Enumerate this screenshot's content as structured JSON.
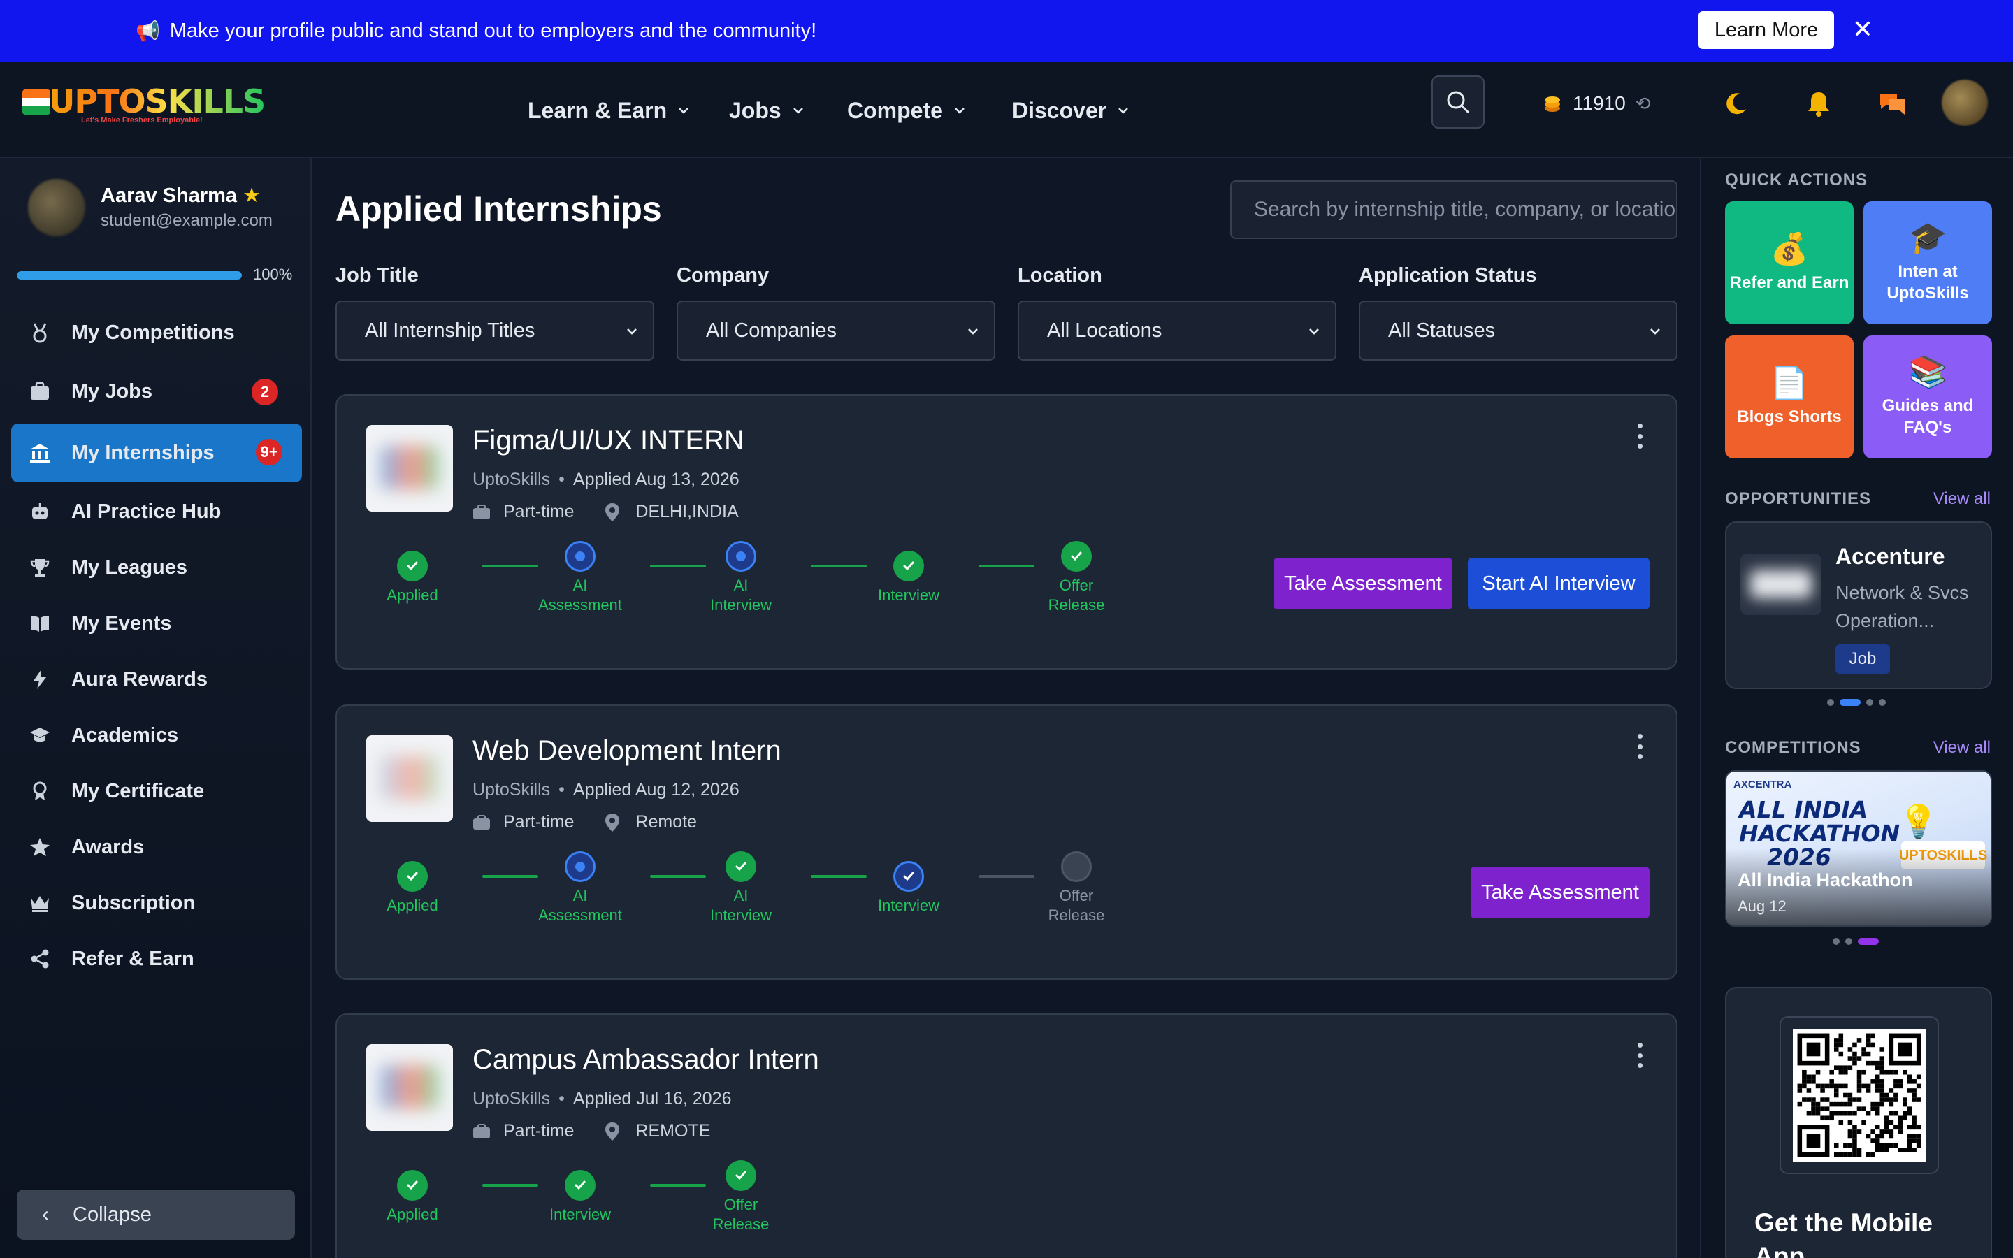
{
  "banner": {
    "icon": "megaphone-icon",
    "message": "Make your profile public and stand out to employers and the community!",
    "learn_more": "Learn More",
    "close": "✕",
    "bg_color": "#1216ee"
  },
  "header": {
    "logo_text": "UPTOSKILLS",
    "logo_tagline": "Let's Make Freshers Employable!",
    "nav": [
      "Learn & Earn",
      "Jobs",
      "Compete",
      "Discover"
    ],
    "coins": "11910"
  },
  "profile": {
    "name": "Aarav Sharma",
    "email": "student@example.com",
    "progress_label": "100%",
    "progress_fraction": 1.0
  },
  "sidebar": {
    "items": [
      {
        "label": "My Competitions",
        "icon": "medal-icon"
      },
      {
        "label": "My Jobs",
        "icon": "briefcase-icon",
        "badge": "2"
      },
      {
        "label": "My Internships",
        "icon": "bank-icon",
        "badge": "9+",
        "active": true
      },
      {
        "label": "AI Practice Hub",
        "icon": "robot-icon"
      },
      {
        "label": "My Leagues",
        "icon": "trophy-icon"
      },
      {
        "label": "My Events",
        "icon": "book-icon"
      },
      {
        "label": "Aura Rewards",
        "icon": "bolt-icon"
      },
      {
        "label": "Academics",
        "icon": "graduation-cap-icon"
      },
      {
        "label": "My Certificate",
        "icon": "award-ribbon-icon"
      },
      {
        "label": "Awards",
        "icon": "star-icon"
      },
      {
        "label": "Subscription",
        "icon": "crown-icon"
      },
      {
        "label": "Refer & Earn",
        "icon": "share-icon"
      }
    ],
    "collapse": "Collapse"
  },
  "main": {
    "title": "Applied Internships",
    "search_placeholder": "Search by internship title, company, or location",
    "filters": [
      {
        "label": "Job Title",
        "value": "All Internship Titles"
      },
      {
        "label": "Company",
        "value": "All Companies"
      },
      {
        "label": "Location",
        "value": "All Locations"
      },
      {
        "label": "Application Status",
        "value": "All Statuses"
      }
    ],
    "cards": [
      {
        "title": "Figma/UI/UX INTERN",
        "company": "UptoSkills",
        "applied": "Applied Aug 13, 2026",
        "type": "Part-time",
        "location": "DELHI,INDIA",
        "steps": [
          {
            "label": [
              "Applied"
            ],
            "state": "done"
          },
          {
            "label": [
              "AI",
              "Assessment"
            ],
            "state": "current"
          },
          {
            "label": [
              "AI",
              "Interview"
            ],
            "state": "current"
          },
          {
            "label": [
              "Interview"
            ],
            "state": "done"
          },
          {
            "label": [
              "Offer",
              "Release"
            ],
            "state": "done"
          }
        ],
        "actions": [
          "Take Assessment",
          "Start AI Interview"
        ]
      },
      {
        "title": "Web Development Intern",
        "company": "UptoSkills",
        "applied": "Applied Aug 12, 2026",
        "type": "Part-time",
        "location": "Remote",
        "steps": [
          {
            "label": [
              "Applied"
            ],
            "state": "done"
          },
          {
            "label": [
              "AI",
              "Assessment"
            ],
            "state": "current"
          },
          {
            "label": [
              "AI",
              "Interview"
            ],
            "state": "done"
          },
          {
            "label": [
              "Interview"
            ],
            "state": "current-check"
          },
          {
            "label": [
              "Offer",
              "Release"
            ],
            "state": "pending"
          }
        ],
        "actions": [
          "Take Assessment"
        ]
      },
      {
        "title": "Campus Ambassador Intern",
        "company": "UptoSkills",
        "applied": "Applied Jul 16, 2026",
        "type": "Part-time",
        "location": "REMOTE",
        "steps": [
          {
            "label": [
              "Applied"
            ],
            "state": "done"
          },
          {
            "label": [
              "Interview"
            ],
            "state": "done"
          },
          {
            "label": [
              "Offer",
              "Release"
            ],
            "state": "done"
          }
        ],
        "actions": []
      }
    ]
  },
  "right_panel": {
    "quick_actions_title": "QUICK ACTIONS",
    "quick_actions": [
      {
        "label": "Refer and Earn",
        "icon": "money-bag-icon",
        "color": "#10b981"
      },
      {
        "label": "Inten at UptoSkills",
        "icon": "graduation-cap-icon",
        "color": "#4f7df5"
      },
      {
        "label": "Blogs Shorts",
        "icon": "document-icon",
        "color": "#f0602a"
      },
      {
        "label": "Guides and FAQ's",
        "icon": "books-icon",
        "color": "#8b5cf6"
      }
    ],
    "opportunities_title": "OPPORTUNITIES",
    "view_all": "View all",
    "opportunity": {
      "company": "Accenture",
      "role": "Network & Svcs Operation...",
      "tag": "Job"
    },
    "competitions_title": "COMPETITIONS",
    "competition": {
      "brand": "AXCENTRA",
      "headline": [
        "ALL INDIA",
        "HACKATHON",
        "2026"
      ],
      "logo": "UPTOSKILLS",
      "title": "All India Hackathon",
      "date": "Aug 12"
    },
    "mobile_title": "Get the Mobile App"
  }
}
